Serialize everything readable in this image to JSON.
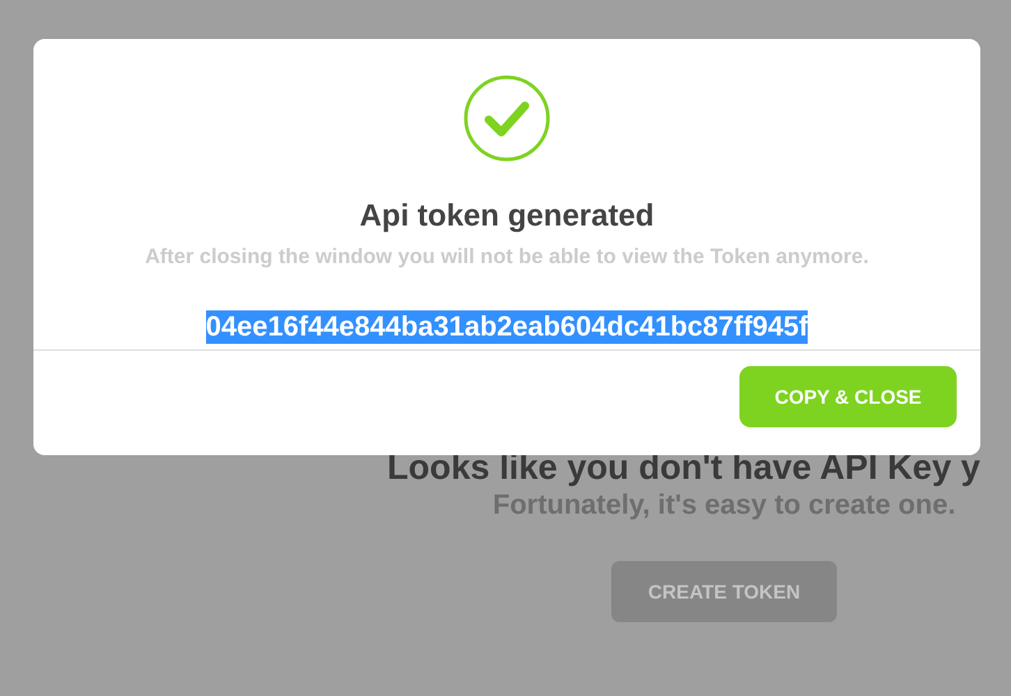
{
  "background": {
    "heading": "Looks like you don't have API Key y",
    "subheading": "Fortunately, it's easy to create one.",
    "button": "CREATE TOKEN"
  },
  "dialog": {
    "title": "Api token generated",
    "message": "After closing the window you will not be able to view the Token anymore.",
    "token": "04ee16f44e844ba31ab2eab604dc41bc87ff945f",
    "button": "COPY & CLOSE"
  }
}
